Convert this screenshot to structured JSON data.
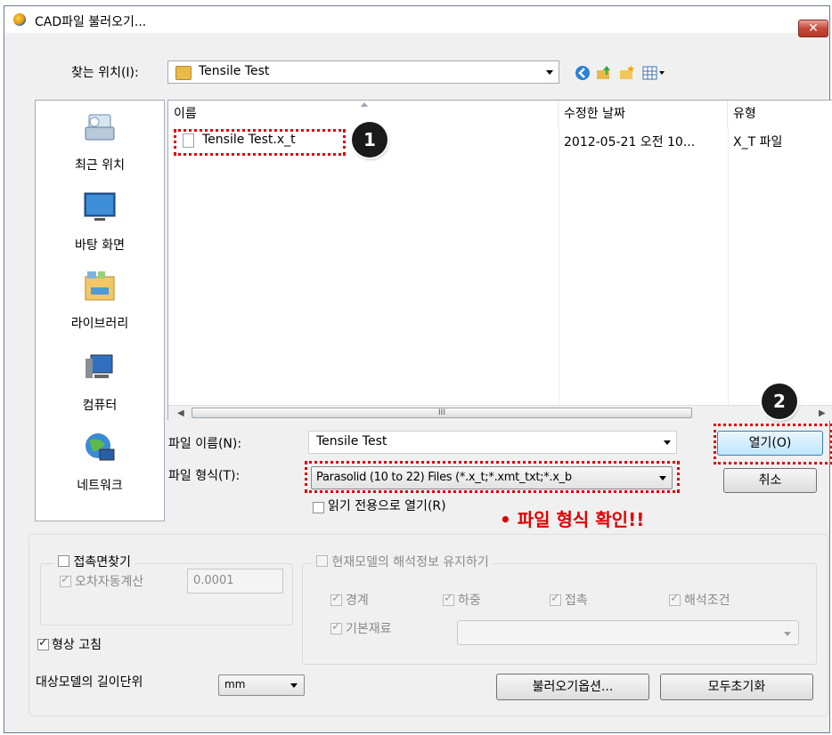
{
  "window": {
    "title": "CAD파일 불러오기...",
    "close_icon": "close-icon"
  },
  "lookin": {
    "label": "찾는 위치(I):",
    "value": "Tensile Test"
  },
  "places": [
    {
      "label": "최근 위치",
      "icon": "recent-places-icon"
    },
    {
      "label": "바탕 화면",
      "icon": "desktop-icon"
    },
    {
      "label": "라이브러리",
      "icon": "library-icon"
    },
    {
      "label": "컴퓨터",
      "icon": "computer-icon"
    },
    {
      "label": "네트워크",
      "icon": "network-icon"
    }
  ],
  "filelist": {
    "columns": [
      "이름",
      "수정한 날짜",
      "유형"
    ],
    "rows": [
      {
        "name": "Tensile Test.x_t",
        "date": "2012-05-21 오전 10...",
        "type": "X_T 파일"
      }
    ],
    "scroll_mid": "III"
  },
  "filename": {
    "label": "파일 이름(N):",
    "value": "Tensile Test"
  },
  "filetype": {
    "label": "파일 형식(T):",
    "value": "Parasolid (10 to 22) Files (*.x_t;*.xmt_txt;*.x_b"
  },
  "readonly": {
    "label": "읽기 전용으로 열기(R)",
    "checked": false
  },
  "buttons": {
    "open": "열기(O)",
    "cancel": "취소",
    "import_options": "불러오기옵션...",
    "reset_all": "모두초기화"
  },
  "annotation": {
    "note": "• 파일 형식 확인!!",
    "badge1": "1",
    "badge2": "2",
    "color": "#e00000"
  },
  "contact": {
    "label": "접촉면찾기",
    "checked": false,
    "tolerance_label": "오차자동계산",
    "tolerance_checked": true,
    "tolerance_value": "0.0001"
  },
  "keep_info": {
    "label": "현재모델의 해석정보 유지하기",
    "checked": false,
    "items": [
      "경계",
      "하중",
      "접촉",
      "해석조건",
      "기본재료"
    ]
  },
  "shape_fix": {
    "label": "형상 고침",
    "checked": true
  },
  "unit": {
    "label": "대상모델의 길이단위",
    "value": "mm"
  }
}
